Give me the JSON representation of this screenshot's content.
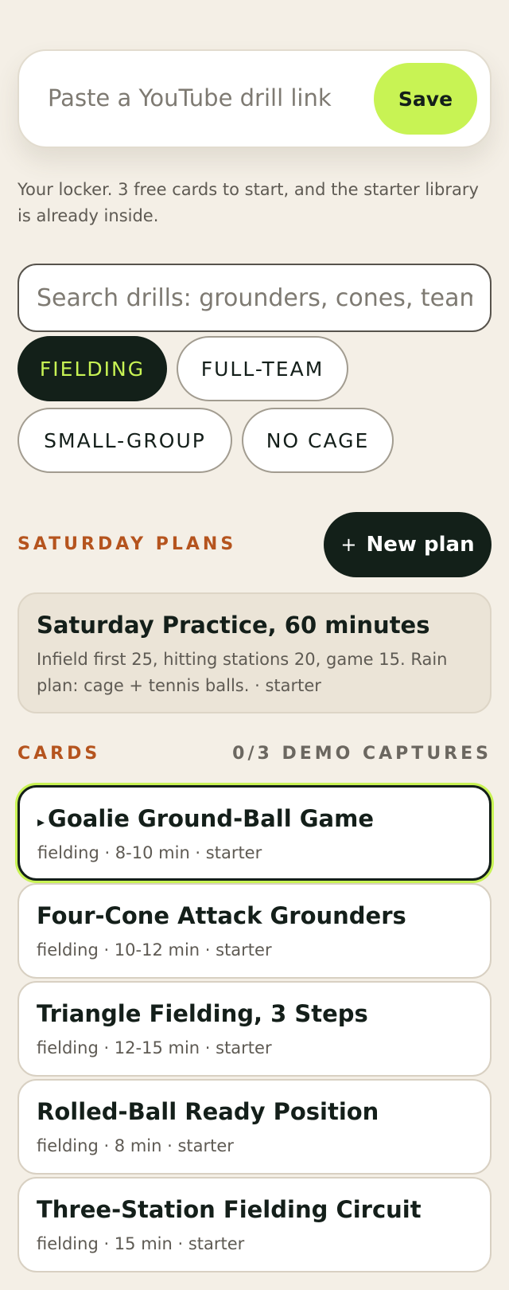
{
  "capture": {
    "placeholder": "Paste a YouTube drill link",
    "save_label": "Save"
  },
  "helper_text": "Your locker. 3 free cards to start, and the starter library is already inside.",
  "search": {
    "placeholder": "Search drills: grounders, cones, team"
  },
  "filters": [
    {
      "label": "FIELDING",
      "active": true
    },
    {
      "label": "FULL-TEAM",
      "active": false
    },
    {
      "label": "SMALL-GROUP",
      "active": false
    },
    {
      "label": "NO CAGE",
      "active": false
    }
  ],
  "plans": {
    "section_label": "SATURDAY PLANS",
    "new_plan_icon": "+",
    "new_plan_label": "New plan",
    "items": [
      {
        "title": "Saturday Practice, 60 minutes",
        "description": "Infield first 25, hitting stations 20, game 15. Rain plan: cage + tennis balls. · starter"
      }
    ]
  },
  "cards": {
    "section_label": "CARDS",
    "count_label": "0/3 DEMO CAPTURES",
    "selected_icon": "▸",
    "items": [
      {
        "title": "Goalie Ground-Ball Game",
        "meta": "fielding · 8-10 min · starter",
        "selected": true
      },
      {
        "title": "Four-Cone Attack Grounders",
        "meta": "fielding · 10-12 min · starter",
        "selected": false
      },
      {
        "title": "Triangle Fielding, 3 Steps",
        "meta": "fielding · 12-15 min · starter",
        "selected": false
      },
      {
        "title": "Rolled-Ball Ready Position",
        "meta": "fielding · 8 min · starter",
        "selected": false
      },
      {
        "title": "Three-Station Fielding Circuit",
        "meta": "fielding · 15 min · starter",
        "selected": false
      }
    ]
  },
  "colors": {
    "background": "#f4efe6",
    "accent": "#c8f354",
    "dark": "#132019",
    "section_label": "#b5541e"
  }
}
